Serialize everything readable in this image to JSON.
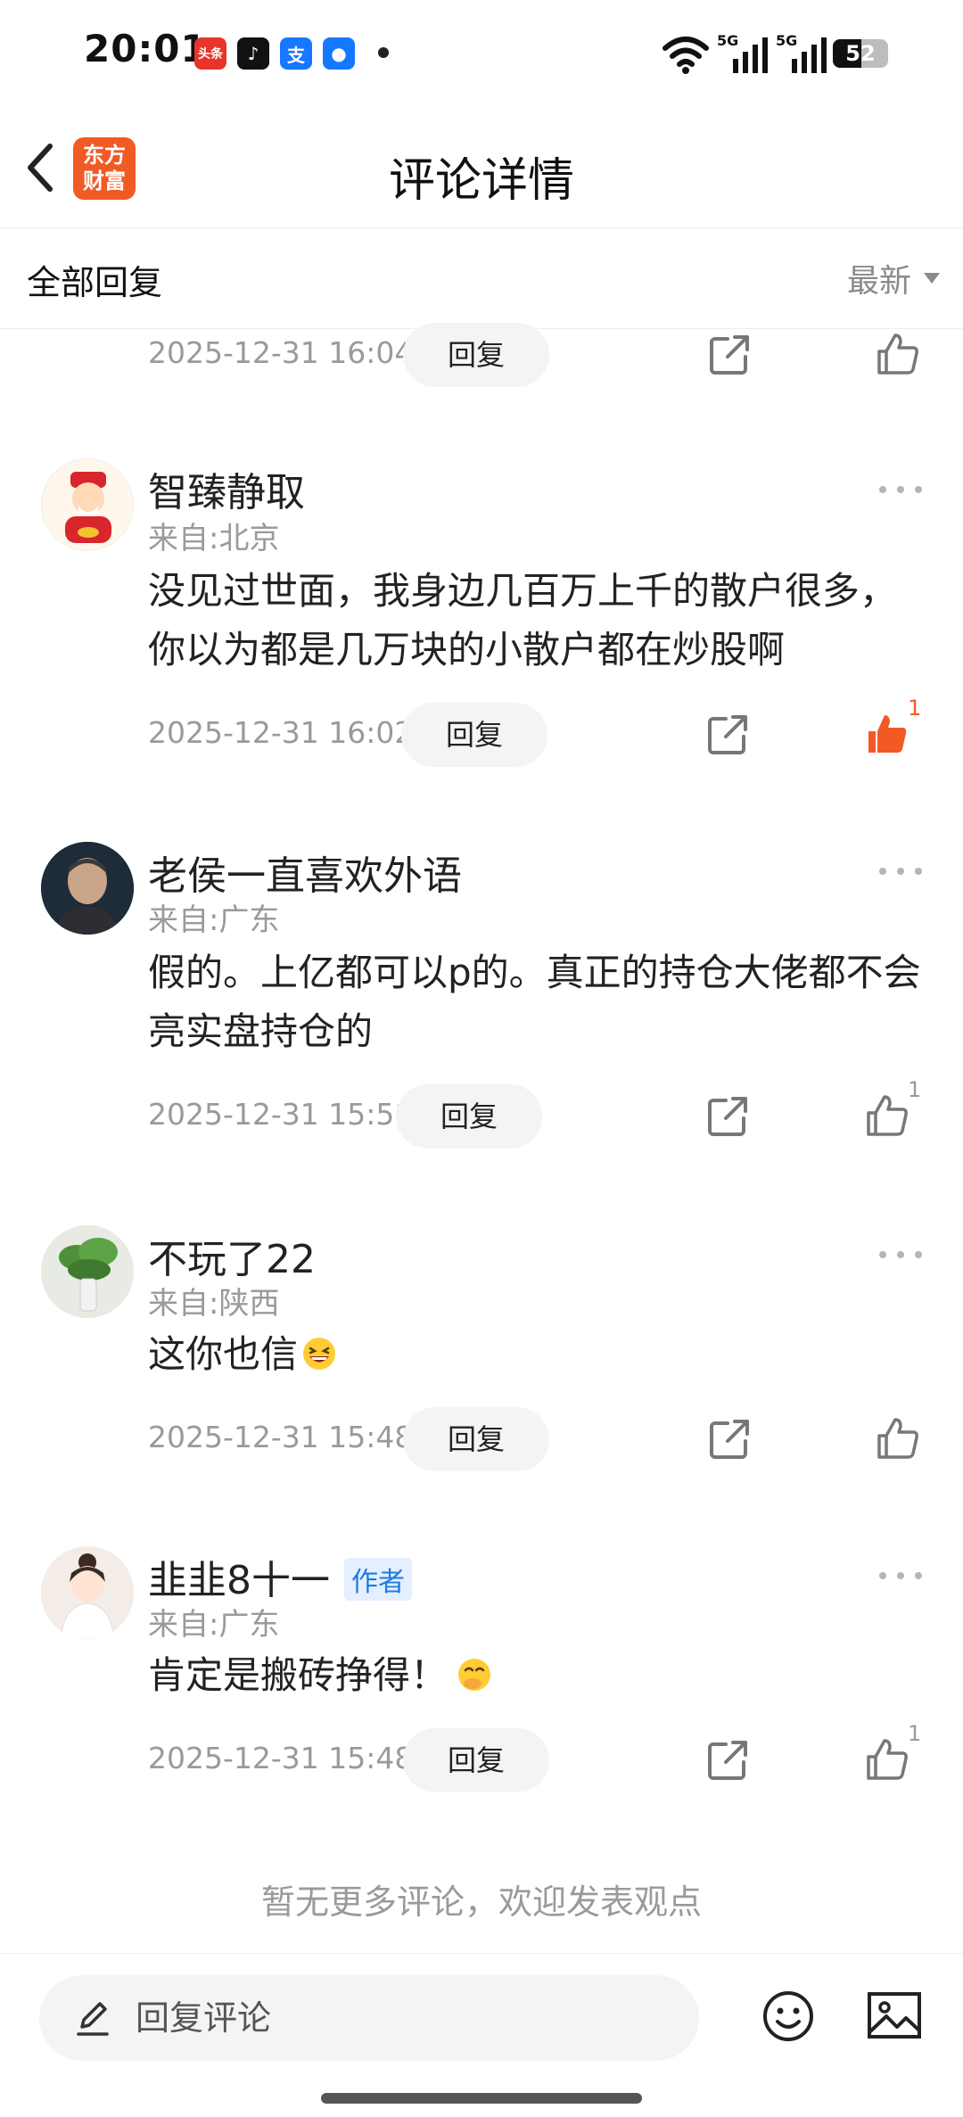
{
  "status_bar": {
    "time": "20:01",
    "battery": "52",
    "battery_level": 0.52,
    "network_1": "5G",
    "network_2": "5G",
    "app_icons": [
      {
        "name": "toutiao-icon",
        "label": "头条",
        "color": "#e8352b"
      },
      {
        "name": "douyin-icon",
        "label": "♪",
        "color": "#111111"
      },
      {
        "name": "alipay-icon",
        "label": "支",
        "color": "#1677ff"
      },
      {
        "name": "app-icon",
        "label": "●",
        "color": "#1677ff"
      }
    ]
  },
  "header": {
    "title": "评论详情",
    "logo_line1": "东方",
    "logo_line2": "财富",
    "brand_color": "#f15a24"
  },
  "filter": {
    "title": "全部回复",
    "sort": "最新"
  },
  "top_partial": {
    "time": "2025-12-31 16:04",
    "reply": "回复"
  },
  "comments": [
    {
      "user": "智臻静取",
      "location": "来自:北京",
      "content": "没见过世面，我身边几百万上千的散户很多，你以为都是几万块的小散户都在炒股啊",
      "time": "2025-12-31 16:02",
      "reply": "回复",
      "likes": "1",
      "liked": true
    },
    {
      "user": "老侯一直喜欢外语",
      "location": "来自:广东",
      "content": "假的。上亿都可以p的。真正的持仓大佬都不会亮实盘持仓的",
      "time": "2025-12-31 15:51",
      "reply": "回复",
      "likes": "1",
      "liked": false
    },
    {
      "user": "不玩了22",
      "location": "来自:陕西",
      "content": "这你也信",
      "emoji": "grinning-emoji",
      "time": "2025-12-31 15:48",
      "reply": "回复",
      "likes": "",
      "liked": false
    },
    {
      "user": "韭韭8十一",
      "badge": "作者",
      "location": "来自:广东",
      "content": "肯定是搬砖挣得！",
      "emoji": "hand-over-mouth-emoji",
      "time": "2025-12-31 15:48",
      "reply": "回复",
      "likes": "1",
      "liked": false
    }
  ],
  "footer_note": "暂无更多评论，欢迎发表观点",
  "bottom_bar": {
    "placeholder": "回复评论"
  }
}
